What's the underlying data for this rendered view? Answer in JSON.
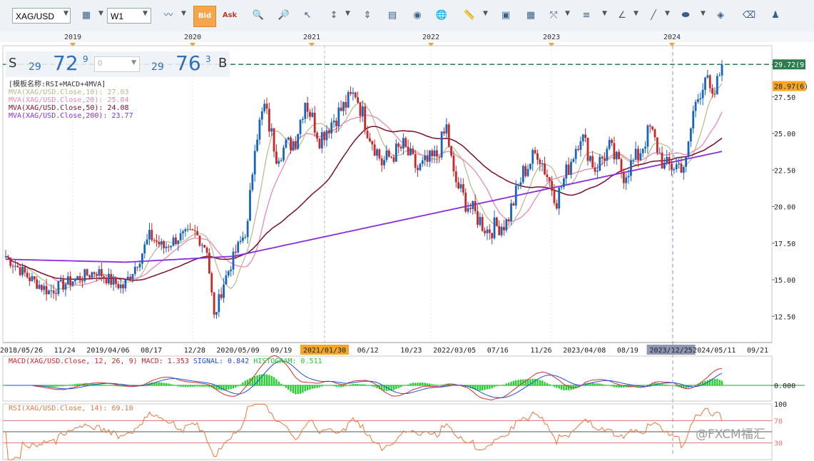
{
  "toolbar": {
    "symbol": "XAG/USD",
    "timeframe": "W1",
    "bid_label": "Bid",
    "ask_label": "Ask",
    "icons": [
      "chart-type-icon",
      "bid-icon",
      "ask-icon",
      "zoom-in-icon",
      "zoom-out-icon",
      "cursor-icon",
      "measure-icon",
      "fit-icon",
      "notes-icon",
      "eye-icon",
      "globe-icon",
      "ruler-icon",
      "image-icon",
      "template-icon",
      "line-tool-icon",
      "hline-icon",
      "angle-icon",
      "trendline-icon",
      "ellipse-icon",
      "fill-icon",
      "eraser-icon",
      "indicators-icon"
    ]
  },
  "quote": {
    "sell_label": "S",
    "sell_prefix": "29",
    "sell_big": "72",
    "sell_sup": "9",
    "lot_value": "0",
    "buy_prefix": "29",
    "buy_big": "76",
    "buy_sup": "3",
    "buy_label": "B"
  },
  "top_years": [
    "2019",
    "2020",
    "2021",
    "2022",
    "2023",
    "2024"
  ],
  "chart_data": {
    "type": "candlestick",
    "symbol": "XAG/USD",
    "timeframe": "W1",
    "template_label": "[模板名称:RSI+MACD+4MVA]",
    "legend": [
      {
        "text": "MVA(XAG/USD.Close,10): 27.03",
        "color": "#b5b88a"
      },
      {
        "text": "MVA(XAG/USD.Close,20): 25.04",
        "color": "#e986b5"
      },
      {
        "text": "MVA(XAG/USD.Close,50): 24.08",
        "color": "#7a0f2a"
      },
      {
        "text": "MVA(XAG/USD.Close,200): 23.77",
        "color": "#8a2be2"
      }
    ],
    "ylim": [
      11.0,
      31.0
    ],
    "y_ticks": [
      12.5,
      15.0,
      17.5,
      20.0,
      22.5,
      25.0,
      27.5
    ],
    "y_tick_labels": [
      "12.50",
      "15.00",
      "17.50",
      "20.00",
      "22.50",
      "25.00",
      "27.50"
    ],
    "price_labels": [
      {
        "text": "29.72(9)",
        "value": 29.72,
        "color": "#2e7d4f"
      },
      {
        "text": "28.97(6)",
        "value": 28.97,
        "color": "#f5a623"
      }
    ],
    "bid_line": 29.72,
    "x_labels": [
      "2018/05/26",
      "11/24",
      "2019/04/06",
      "08/17",
      "12/28",
      "2020/05/09",
      "09/19",
      "2021/01/30",
      "06/12",
      "10/23",
      "2022/03/05",
      "07/16",
      "11/26",
      "2023/04/08",
      "08/19",
      "2023/12/25",
      "2024/05/11",
      "09/21"
    ],
    "highlighted_x_labels": [
      "2021/01/30",
      "2023/12/25"
    ],
    "close_keypoints": [
      {
        "t": 0,
        "v": 16.6
      },
      {
        "t": 10,
        "v": 15.1
      },
      {
        "t": 18,
        "v": 14.2
      },
      {
        "t": 27,
        "v": 14.9
      },
      {
        "t": 38,
        "v": 15.6
      },
      {
        "t": 44,
        "v": 14.9
      },
      {
        "t": 49,
        "v": 14.5
      },
      {
        "t": 56,
        "v": 16.5
      },
      {
        "t": 60,
        "v": 18.0
      },
      {
        "t": 66,
        "v": 17.2
      },
      {
        "t": 72,
        "v": 17.9
      },
      {
        "t": 79,
        "v": 18.2
      },
      {
        "t": 84,
        "v": 17.1
      },
      {
        "t": 87,
        "v": 12.4
      },
      {
        "t": 91,
        "v": 14.8
      },
      {
        "t": 96,
        "v": 16.9
      },
      {
        "t": 101,
        "v": 18.6
      },
      {
        "t": 104,
        "v": 24.5
      },
      {
        "t": 108,
        "v": 26.8
      },
      {
        "t": 113,
        "v": 23.6
      },
      {
        "t": 121,
        "v": 24.6
      },
      {
        "t": 125,
        "v": 27.3
      },
      {
        "t": 131,
        "v": 24.7
      },
      {
        "t": 137,
        "v": 26.0
      },
      {
        "t": 146,
        "v": 27.8
      },
      {
        "t": 151,
        "v": 25.3
      },
      {
        "t": 157,
        "v": 23.0
      },
      {
        "t": 166,
        "v": 24.1
      },
      {
        "t": 172,
        "v": 22.5
      },
      {
        "t": 180,
        "v": 23.5
      },
      {
        "t": 184,
        "v": 25.4
      },
      {
        "t": 187,
        "v": 22.0
      },
      {
        "t": 192,
        "v": 20.3
      },
      {
        "t": 201,
        "v": 18.4
      },
      {
        "t": 209,
        "v": 18.9
      },
      {
        "t": 216,
        "v": 22.3
      },
      {
        "t": 222,
        "v": 23.8
      },
      {
        "t": 230,
        "v": 20.5
      },
      {
        "t": 240,
        "v": 25.0
      },
      {
        "t": 246,
        "v": 22.6
      },
      {
        "t": 252,
        "v": 24.0
      },
      {
        "t": 258,
        "v": 22.2
      },
      {
        "t": 264,
        "v": 23.5
      },
      {
        "t": 269,
        "v": 25.3
      },
      {
        "t": 275,
        "v": 22.7
      },
      {
        "t": 284,
        "v": 22.9
      },
      {
        "t": 287,
        "v": 26.5
      },
      {
        "t": 292,
        "v": 29.0
      },
      {
        "t": 295,
        "v": 27.1
      },
      {
        "t": 299,
        "v": 29.7
      }
    ],
    "macd": {
      "label": "MACD(XAG/USD.Close, 12, 26, 9)",
      "macd_text": "MACD: 1.353",
      "signal_text": "SIGNAL: 0.842",
      "histogram_text": "HISTOGRAM: 0.511",
      "zero_label": "0.000",
      "macd": 1.353,
      "signal": 0.842,
      "histogram": 0.511
    },
    "rsi": {
      "label": "RSI(XAG/USD.Close, 14): 69.10",
      "value": 69.1,
      "levels": [
        70,
        30
      ],
      "axis_labels": [
        "100",
        "70",
        "30"
      ]
    }
  },
  "watermark": "@FXCM福汇"
}
